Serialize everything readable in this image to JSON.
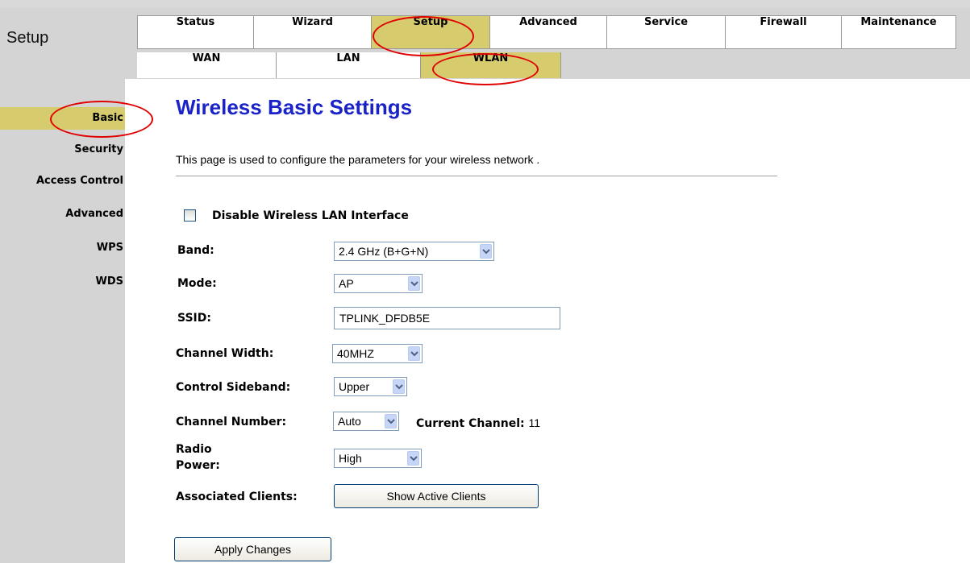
{
  "header": {
    "logo": "Setup"
  },
  "tabs": [
    {
      "label": "Status"
    },
    {
      "label": "Wizard"
    },
    {
      "label": "Setup"
    },
    {
      "label": "Advanced"
    },
    {
      "label": "Service"
    },
    {
      "label": "Firewall"
    },
    {
      "label": "Maintenance"
    }
  ],
  "subtabs": [
    {
      "label": "WAN"
    },
    {
      "label": "LAN"
    },
    {
      "label": "WLAN"
    }
  ],
  "sidebar": [
    {
      "label": "Basic"
    },
    {
      "label": "Security"
    },
    {
      "label": "Access Control"
    },
    {
      "label": "Advanced"
    },
    {
      "label": "WPS"
    },
    {
      "label": "WDS"
    }
  ],
  "main": {
    "title": "Wireless Basic Settings",
    "description": "This page is used to configure the parameters for your wireless network .",
    "disable_label": "Disable Wireless LAN Interface",
    "band_label": "Band:",
    "band_value": "2.4 GHz (B+G+N)",
    "mode_label": "Mode:",
    "mode_value": "AP",
    "ssid_label": "SSID:",
    "ssid_value": "TPLINK_DFDB5E",
    "channel_width_label": "Channel Width:",
    "channel_width_value": "40MHZ",
    "sideband_label": "Control Sideband:",
    "sideband_value": "Upper",
    "channel_number_label": "Channel Number:",
    "channel_number_value": "Auto",
    "current_channel_label": "Current Channel:",
    "current_channel_value": "11",
    "radio_power_label_1": "Radio",
    "radio_power_label_2": "Power:",
    "radio_power_value": "High",
    "associated_label": "Associated Clients:",
    "show_clients_button": "Show Active Clients",
    "apply_button": "Apply Changes"
  },
  "colors": {
    "active_tab": "#d6cc6e",
    "title": "#1a23c8",
    "annotation": "#e00000",
    "chrome": "#d4d4d4"
  }
}
